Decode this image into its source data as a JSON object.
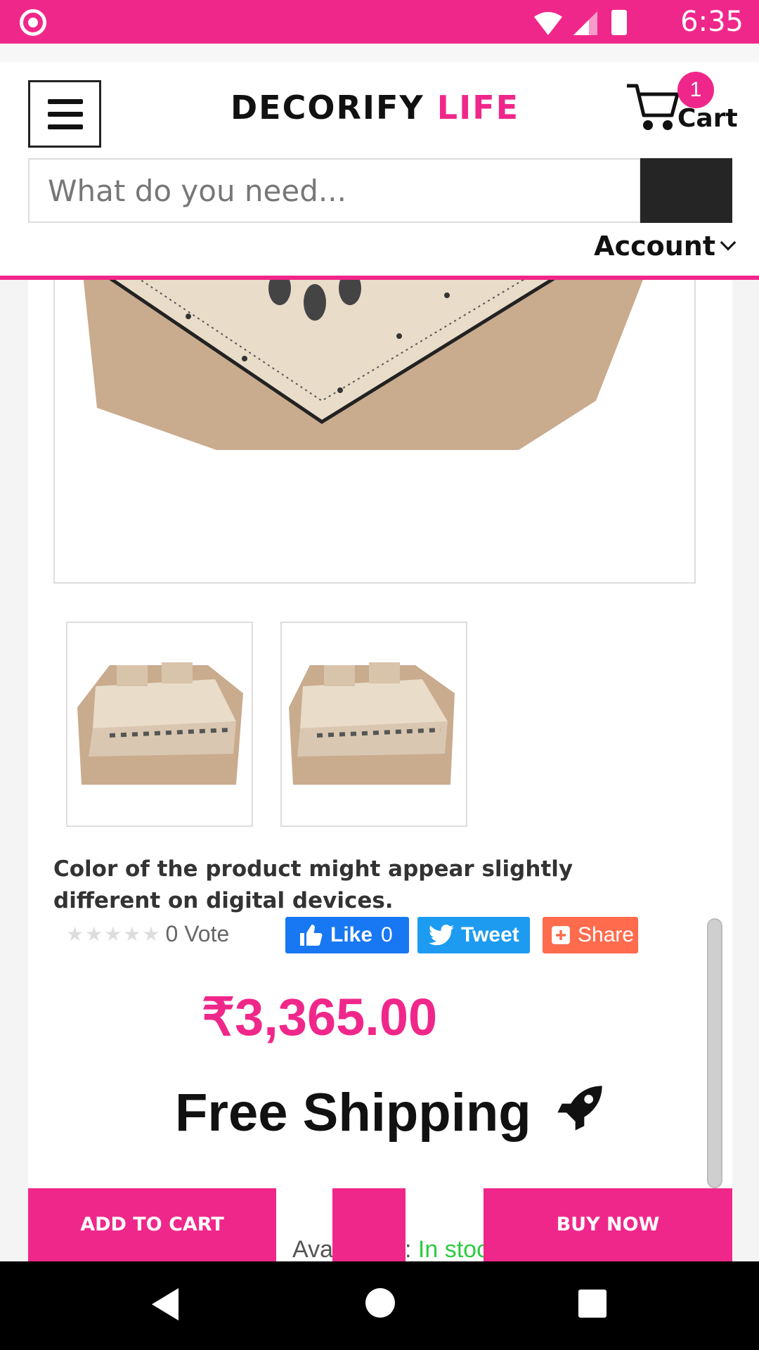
{
  "status_bar": {
    "time": "6:35"
  },
  "header": {
    "logo_part1": "DECORIFY",
    "logo_part2": "LIFE",
    "cart_count": "1",
    "cart_label": "Cart",
    "search_placeholder": "What do you need...",
    "account_label": "Account"
  },
  "product": {
    "color_notice": "Color of the product might appear slightly different on digital devices.",
    "vote_count": "0 Vote",
    "stars": "★★★★★",
    "like_label": "Like",
    "like_count": "0",
    "tweet_label": "Tweet",
    "share_label": "Share",
    "price": "₹3,365.00",
    "shipping": "Free Shipping",
    "availability_label": "Availability:",
    "availability_value": "In stock"
  },
  "actions": {
    "add_to_cart": "ADD TO CART",
    "buy_now": "BUY NOW"
  },
  "colors": {
    "brand": "#f0278a",
    "facebook": "#1877f2",
    "twitter": "#1d9bf0",
    "share": "#ff6b4d",
    "in_stock": "#2ecc40"
  },
  "icons": [
    "menu-icon",
    "cart-icon",
    "search-icon",
    "chevron-down-icon",
    "thumbs-up-icon",
    "twitter-bird-icon",
    "plus-square-icon",
    "rocket-icon",
    "back-icon",
    "home-icon",
    "recents-icon",
    "wifi-icon",
    "signal-icon",
    "battery-icon"
  ]
}
